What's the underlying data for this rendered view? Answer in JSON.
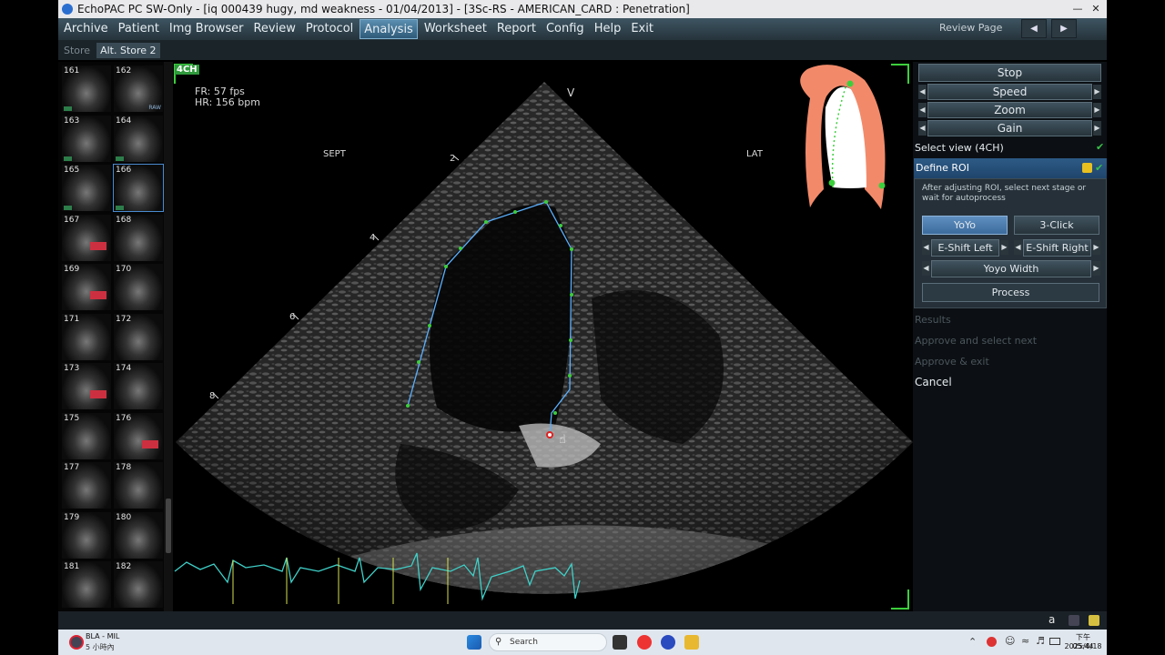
{
  "titlebar": {
    "title": "EchoPAC PC SW-Only - [iq 000439 hugy, md weakness - 01/04/2013] - [3Sc-RS - AMERICAN_CARD : Penetration]"
  },
  "menu": {
    "items": [
      "Archive",
      "Patient",
      "Img Browser",
      "Review",
      "Protocol",
      "Analysis",
      "Worksheet",
      "Report",
      "Config",
      "Help",
      "Exit"
    ],
    "active": "Analysis",
    "review_page": "Review Page"
  },
  "subbar": {
    "store": "Store",
    "alt_store": "Alt. Store 2"
  },
  "thumbnails": [
    {
      "num": "161",
      "tag": true
    },
    {
      "num": "162",
      "raw": "RAW"
    },
    {
      "num": "163",
      "tag": true
    },
    {
      "num": "164",
      "tag": true
    },
    {
      "num": "165",
      "tag": true
    },
    {
      "num": "166",
      "tag": true,
      "selected": true
    },
    {
      "num": "167",
      "red": true
    },
    {
      "num": "168"
    },
    {
      "num": "169",
      "red": true
    },
    {
      "num": "170"
    },
    {
      "num": "171"
    },
    {
      "num": "172"
    },
    {
      "num": "173",
      "red": true
    },
    {
      "num": "174"
    },
    {
      "num": "175"
    },
    {
      "num": "176",
      "red": true
    },
    {
      "num": "177"
    },
    {
      "num": "178"
    },
    {
      "num": "179"
    },
    {
      "num": "180"
    },
    {
      "num": "181"
    },
    {
      "num": "182"
    }
  ],
  "image": {
    "view_badge": "4CH",
    "fr": "FR: 57 fps",
    "hr": "HR: 156 bpm",
    "apex_label": "V",
    "sept_label": "SEPT",
    "lat_label": "LAT",
    "depth_marks": [
      "2",
      "4",
      "6",
      "8"
    ]
  },
  "rightpanel": {
    "stop": "Stop",
    "speed": "Speed",
    "zoom": "Zoom",
    "gain": "Gain",
    "select_view": "Select view (4CH)",
    "define_roi": "Define ROI",
    "roi_help": "After adjusting ROI, select next stage or wait for autoprocess",
    "yoyo": "YoYo",
    "three_click": "3-Click",
    "eshift_left": "E-Shift Left",
    "eshift_right": "E-Shift Right",
    "yoyo_width": "Yoyo Width",
    "process": "Process",
    "results": "Results",
    "approve_select": "Approve and select next",
    "approve_exit": "Approve & exit",
    "cancel": "Cancel"
  },
  "appbottom": {
    "key": "a"
  },
  "taskbar": {
    "notif_title": "BLA - MIL",
    "notif_sub": "5 小時內",
    "search": "Search",
    "time": "下午 05:44",
    "date": "2025/4/18"
  },
  "colors": {
    "accent": "#2d5a86",
    "contour": "#5ab0ff",
    "node": "#3ccf3c",
    "tissue_model": "#f28a6a"
  }
}
